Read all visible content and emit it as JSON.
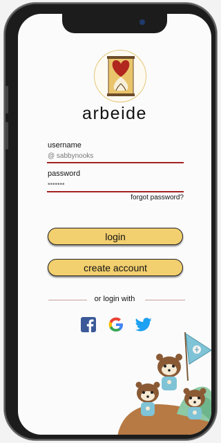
{
  "app": {
    "title": "arbeide"
  },
  "login_form": {
    "username_label": "username",
    "username_value": "@ sabbynooks",
    "password_label": "password",
    "password_value": "•••••••",
    "forgot_password": "forgot password?",
    "login_button": "login",
    "create_account_button": "create account"
  },
  "social_login": {
    "divider_text": "or login with",
    "providers": [
      "facebook",
      "google",
      "twitter"
    ]
  },
  "colors": {
    "accent_button": "#f2cf6f",
    "underline": "#a32121",
    "logo_heart": "#b1261e",
    "facebook": "#3b5998",
    "twitter": "#1da1f2"
  }
}
